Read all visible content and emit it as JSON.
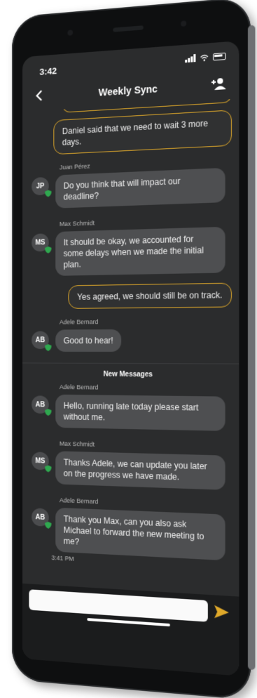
{
  "status": {
    "time": "3:42"
  },
  "header": {
    "title": "Weekly Sync"
  },
  "messages_before": [
    {
      "type": "out",
      "text": "Daniel said that we need to wait 3 more days."
    },
    {
      "type": "in",
      "sender": "Juan Pérez",
      "initials": "JP",
      "text": "Do you think that will impact our deadline?"
    },
    {
      "type": "in",
      "sender": "Max Schmidt",
      "initials": "MS",
      "text": "It should be okay, we accounted for some delays when we made the initial plan."
    },
    {
      "type": "out",
      "text": "Yes agreed, we should still be on track."
    },
    {
      "type": "in",
      "sender": "Adele Bernard",
      "initials": "AB",
      "text": "Good to hear!"
    }
  ],
  "divider_label": "New Messages",
  "messages_after": [
    {
      "type": "in",
      "sender": "Adele Bernard",
      "initials": "AB",
      "text": "Hello, running late today please start without me."
    },
    {
      "type": "in",
      "sender": "Max Schmidt",
      "initials": "MS",
      "text": "Thanks Adele, we can update you later on the progress we have made."
    },
    {
      "type": "in",
      "sender": "Adele Bernard",
      "initials": "AB",
      "text": "Thank you Max, can you also ask Michael to forward the new meeting to me?",
      "time": "3:41 PM"
    }
  ],
  "composer": {
    "placeholder": ""
  },
  "colors": {
    "accent": "#e0a92a",
    "verified": "#2fa84f"
  }
}
